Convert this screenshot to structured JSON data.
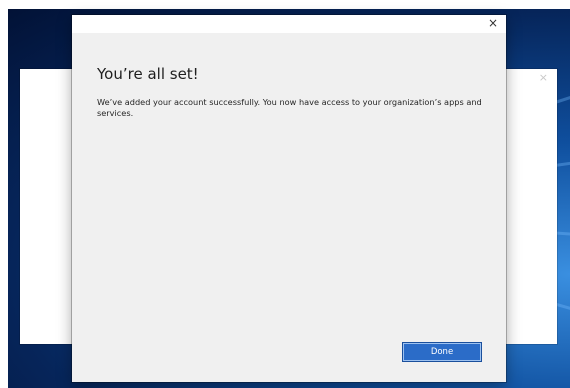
{
  "background_window": {
    "close_glyph": "×"
  },
  "dialog": {
    "close_glyph": "×",
    "heading": "You’re all set!",
    "message": "We’ve added your account successfully. You now have access to your organization’s apps and services.",
    "done_label": "Done"
  },
  "colors": {
    "accent": "#2b6cc8",
    "dialog_background": "#f0f0f0",
    "desktop_blue": "#0f4f9e"
  },
  "icons": {
    "dialog_close": "close-icon",
    "background_close": "close-icon"
  }
}
